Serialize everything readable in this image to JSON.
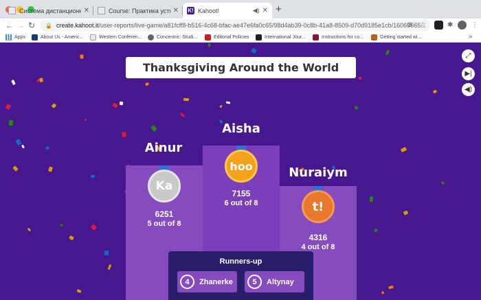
{
  "tabs": [
    {
      "title": "Система дистанционного обу",
      "favicon": "page-icon"
    },
    {
      "title": "Course: Практика устной и пи",
      "favicon": "page-icon"
    },
    {
      "title": "Kahoot!",
      "favicon": "kahoot-icon",
      "favicon_text": "K!",
      "audio": "speaker-icon"
    }
  ],
  "address": {
    "host": "create.kahoot.it",
    "path": "/user-reports/live-game/a81fcff8-b516-4c68-bfac-ae47e6fa0c65/98d4ab39-0c8b-41a8-8509-d70d9185e1cb/16069665..."
  },
  "bookmarks": [
    {
      "label": "Apps"
    },
    {
      "label": "About Us - Americ..."
    },
    {
      "label": "Western Conferen..."
    },
    {
      "label": "Concentric: Studi..."
    },
    {
      "label": "Editorial Policies"
    },
    {
      "label": "International Jour..."
    },
    {
      "label": "Instructions for co..."
    },
    {
      "label": "Getting started wi..."
    }
  ],
  "quiz": {
    "title": "Thanksgiving Around the World"
  },
  "podium": {
    "first": {
      "name": "Aisha",
      "avatar_text": "hoo",
      "score": "7155",
      "correct": "6 out of 8"
    },
    "second": {
      "name": "Ainur",
      "avatar_text": "Ka",
      "score": "6251",
      "correct": "5 out of 8"
    },
    "third": {
      "name": "Nuraiym",
      "avatar_text": "t!",
      "score": "4316",
      "correct": "4 out of 8"
    }
  },
  "runners_up": {
    "title": "Runners-up",
    "items": [
      {
        "rank": "4",
        "name": "Zhanerke"
      },
      {
        "rank": "5",
        "name": "Altynay"
      }
    ]
  },
  "colors": {
    "background": "#46178f",
    "podium": "#864cbf",
    "runners_panel": "#2a1e6b",
    "gold": "#f4a11c",
    "silver": "#c9c9c9",
    "bronze": "#e8782c"
  }
}
